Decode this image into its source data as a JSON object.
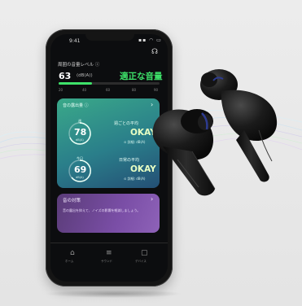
{
  "status_bar": {
    "time": "9:41",
    "icons": "▪▪ ◠ ▭"
  },
  "level": {
    "title": "周囲の音量レベル ⓘ",
    "value": "63",
    "unit": "(dB(A))",
    "verdict": "適正な音量",
    "progress": 0.33,
    "ticks": [
      "20",
      "40",
      "60",
      "80",
      "90"
    ],
    "accent_color": "#3ee26a"
  },
  "exposure_card": {
    "title": "音の露出量 ⓘ",
    "weekly": {
      "ring_label": "週",
      "value": "78",
      "unit": "dB(A)",
      "title": "週ごとの平均",
      "verdict": "OKAY",
      "sub": "⊙ 詳細: dB(A)"
    },
    "daily": {
      "ring_label": "今日",
      "value": "69",
      "unit": "dB(A)",
      "title": "日常の平均",
      "verdict": "OKAY",
      "sub": "⊙ 詳細: dB(A)"
    }
  },
  "tips_card": {
    "title": "音の対策",
    "text": "音の露出を抑えて、ノイズの影響を軽減しましょう。"
  },
  "bottom_nav": {
    "items": [
      {
        "icon": "home-icon",
        "label": "ホーム"
      },
      {
        "icon": "equalizer-icon",
        "label": "サウンド"
      },
      {
        "icon": "device-icon",
        "label": "デバイス"
      }
    ]
  }
}
